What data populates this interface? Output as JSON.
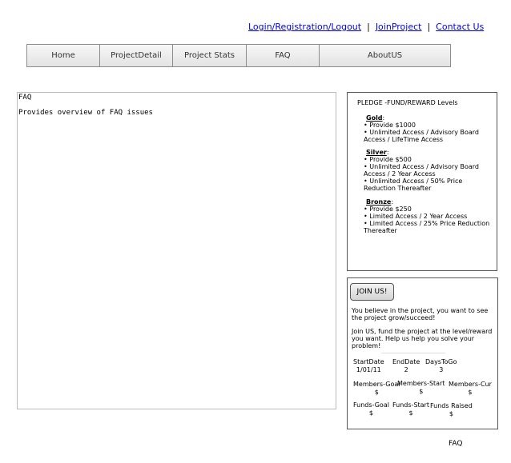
{
  "top_links": {
    "login": "Login/Registration/Logout",
    "sep1": "|",
    "join": "JoinProject",
    "sep2": "|",
    "contact": "Contact Us"
  },
  "nav": {
    "tabs": [
      "Home",
      "ProjectDetail",
      "Project Stats",
      "FAQ",
      "AboutUS"
    ]
  },
  "main": {
    "title": "FAQ",
    "description": "Provides overview of FAQ issues"
  },
  "pledge": {
    "heading": "PLEDGE -FUND/REWARD Levels",
    "levels": [
      {
        "name": "Gold",
        "colon": ":",
        "lines": [
          "• Provide $1000",
          "• Unlimited Access / Advisory Board Access / LifeTime Access"
        ]
      },
      {
        "name": "Silver",
        "colon": ":",
        "lines": [
          "• Provide $500",
          "• Unlimited Access / Advisory Board Access / 2 Year Access",
          "• Unlimited Access / 50% Price Reduction Thereafter"
        ]
      },
      {
        "name": "Bronze",
        "colon": ":",
        "lines": [
          "• Provide $250",
          "• Limited Access /  2 Year Access",
          "• Limited Access / 25% Price Reduction Thereafter"
        ]
      }
    ]
  },
  "join": {
    "button": "JOIN US!",
    "p1": "You believe in the project, you want  to see the project grow/succeed!",
    "p2": "Join US, fund the project at the level/reward you want. Help us help you solve your problem!",
    "stats": {
      "start_date_label": "StartDate",
      "start_date_value": "1/01/11",
      "end_date_label": "EndDate",
      "end_date_value": "2",
      "days_to_go_label": "DaysToGo",
      "days_to_go_value": "3",
      "members_goal_label": "Members-Goal",
      "members_goal_value": "$",
      "members_start_label": "Members-Start",
      "members_start_value": "$",
      "members_cur_label": "Members-Cur",
      "members_cur_value": "$",
      "funds_goal_label": "Funds-Goal",
      "funds_goal_value": "$",
      "funds_start_label": "Funds-Start",
      "funds_start_value": "$",
      "funds_raised_label": "Funds Raised",
      "funds_raised_value": "$"
    }
  },
  "footer": {
    "text": "FAQ"
  }
}
